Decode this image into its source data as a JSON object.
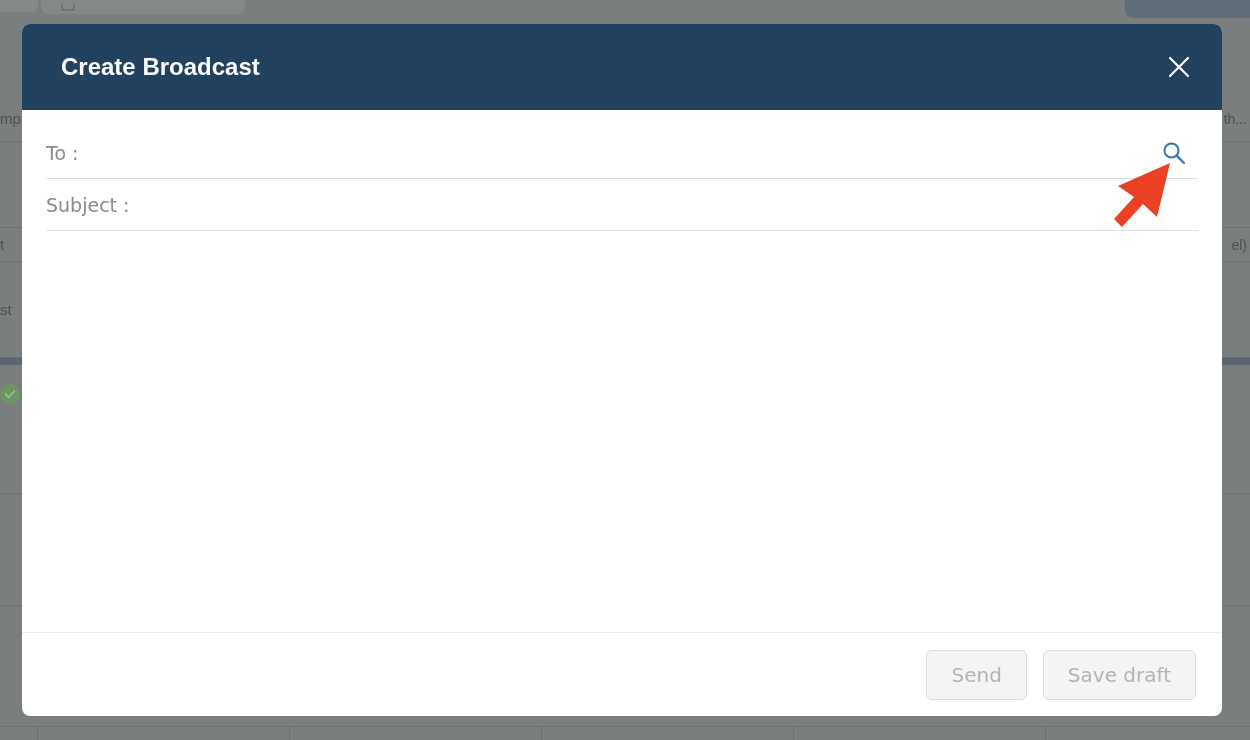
{
  "background": {
    "rows": [
      {
        "kind": "text",
        "left": "mp",
        "right": "th..."
      },
      {
        "kind": "blank"
      },
      {
        "kind": "text",
        "left": "t",
        "right": "el)"
      },
      {
        "kind": "text",
        "left": "st"
      },
      {
        "kind": "bar"
      },
      {
        "kind": "status"
      },
      {
        "kind": "blank"
      },
      {
        "kind": "blank"
      }
    ]
  },
  "dialog": {
    "title": "Create Broadcast",
    "fields": [
      {
        "label": "To :",
        "kind": "search"
      },
      {
        "label": "Subject :",
        "kind": "text"
      }
    ],
    "buttons": [
      {
        "label": "Send",
        "disabled": true
      },
      {
        "label": "Save draft",
        "disabled": true
      }
    ]
  }
}
